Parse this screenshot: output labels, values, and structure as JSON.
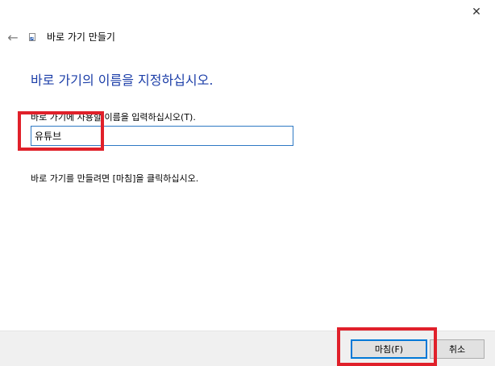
{
  "window": {
    "close_glyph": "✕"
  },
  "header": {
    "back_glyph": "←",
    "title": "바로 가기 만들기"
  },
  "main": {
    "heading": "바로 가기의 이름을 지정하십시오.",
    "prompt_label": "바로 가기에 사용할 이름을 입력하십시오(T).",
    "name_value": "유튜브",
    "finish_hint": "바로 가기를 만들려면 [마침]을 클릭하십시오."
  },
  "footer": {
    "finish_label": "마침(F)",
    "cancel_label": "취소"
  },
  "colors": {
    "heading": "#1c3ea8",
    "highlight": "#e0202a",
    "input_border": "#2f79c4",
    "default_button_border": "#0078d7",
    "footer_background": "#f0f0f0"
  }
}
